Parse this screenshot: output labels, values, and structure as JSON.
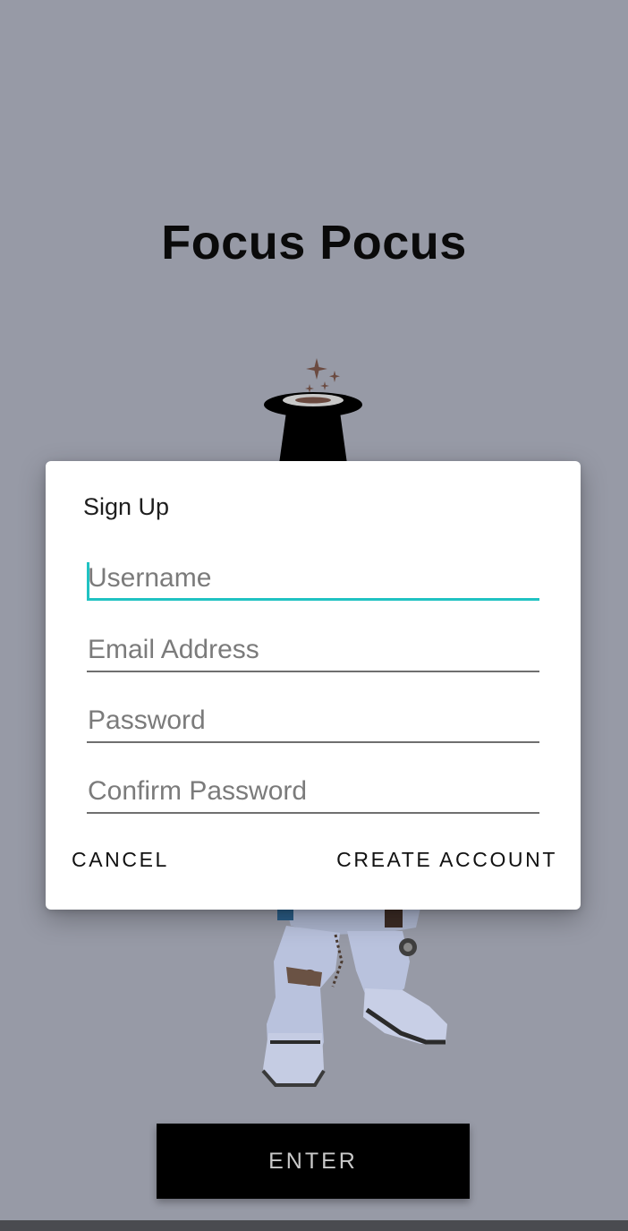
{
  "app": {
    "title": "Focus Pocus"
  },
  "dialog": {
    "title": "Sign Up",
    "fields": [
      {
        "placeholder": "Username",
        "value": "",
        "focused": true
      },
      {
        "placeholder": "Email Address",
        "value": ""
      },
      {
        "placeholder": "Password",
        "value": ""
      },
      {
        "placeholder": "Confirm Password",
        "value": ""
      }
    ],
    "cancel_label": "CANCEL",
    "create_label": "CREATE ACCOUNT"
  },
  "enter_button": {
    "label": "ENTER"
  },
  "icons": {
    "logo": "magic-hat-icon",
    "character": "robot-character-image"
  },
  "colors": {
    "background": "#979aa6",
    "accent": "#20c2c2",
    "sparkle": "#6b4a40"
  }
}
